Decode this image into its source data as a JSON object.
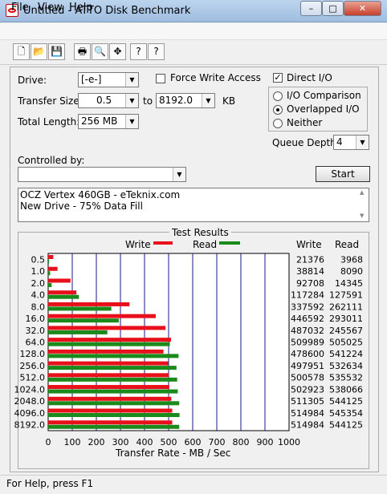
{
  "window": {
    "title": "Untitled - ATTO Disk Benchmark",
    "minimize": "–",
    "maximize": "□",
    "close": "✕"
  },
  "menu": [
    "File",
    "View",
    "Help"
  ],
  "toolbar": [
    {
      "name": "new-icon",
      "glyph": "🗋"
    },
    {
      "name": "open-icon",
      "glyph": "📂"
    },
    {
      "name": "save-icon",
      "glyph": "💾"
    },
    {
      "name": "print-icon",
      "glyph": "🖶"
    },
    {
      "name": "print-preview-icon",
      "glyph": "🔍"
    },
    {
      "name": "move-icon",
      "glyph": "✥"
    },
    {
      "name": "help-icon",
      "glyph": "?"
    },
    {
      "name": "context-help-icon",
      "glyph": "?"
    }
  ],
  "form": {
    "drive_label": "Drive:",
    "drive_value": "[-e-]",
    "force_write_label": "Force Write Access",
    "direct_io_label": "Direct I/O",
    "transfer_size_label": "Transfer Size:",
    "transfer_from": "0.5",
    "to_label": "to",
    "transfer_to": "8192.0",
    "kb_label": "KB",
    "total_length_label": "Total Length:",
    "total_length_value": "256 MB",
    "io_comparison": "I/O Comparison",
    "overlapped_io": "Overlapped I/O",
    "neither": "Neither",
    "queue_depth_label": "Queue Depth:",
    "queue_depth_value": "4",
    "controlled_by_label": "Controlled by:",
    "controlled_by_value": "",
    "start_label": "Start",
    "description_line1": "OCZ Vertex 460GB - eTeknix.com",
    "description_line2": "New Drive - 75% Data Fill"
  },
  "results_title": "Test Results",
  "legend": {
    "write": "Write",
    "read": "Read",
    "write_color": "#e8101a",
    "read_color": "#1a8a1a"
  },
  "columns": {
    "write": "Write",
    "read": "Read"
  },
  "x_axis_label": "Transfer Rate - MB / Sec",
  "chart_data": {
    "type": "bar",
    "categories": [
      "0.5",
      "1.0",
      "2.0",
      "4.0",
      "8.0",
      "16.0",
      "32.0",
      "64.0",
      "128.0",
      "256.0",
      "512.0",
      "1024.0",
      "2048.0",
      "4096.0",
      "8192.0"
    ],
    "series": [
      {
        "name": "Write",
        "values": [
          21376,
          38814,
          92708,
          117284,
          337592,
          446592,
          487032,
          509989,
          478600,
          497951,
          500578,
          502923,
          511305,
          514984,
          514984
        ]
      },
      {
        "name": "Read",
        "values": [
          3968,
          8090,
          14345,
          127591,
          262111,
          293011,
          245567,
          505025,
          541224,
          532634,
          535532,
          538066,
          544125,
          545354,
          544125
        ]
      }
    ],
    "xlabel": "Transfer Rate - MB / Sec",
    "xlim": [
      0,
      1000
    ],
    "xticks": [
      "0",
      "100",
      "200",
      "300",
      "400",
      "500",
      "600",
      "700",
      "800",
      "900",
      "1000"
    ]
  },
  "status": "For Help, press F1"
}
